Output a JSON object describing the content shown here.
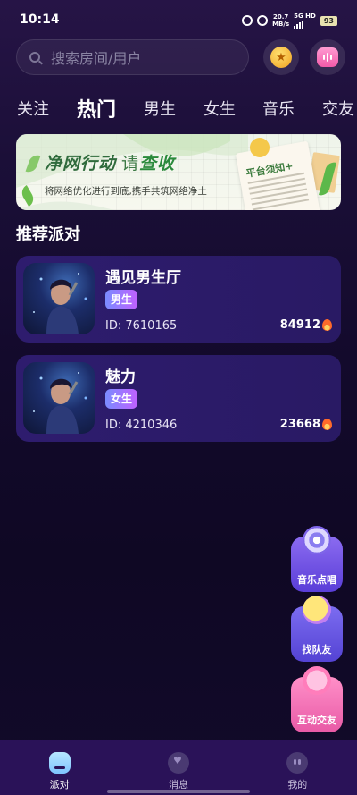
{
  "status_bar": {
    "time": "10:14",
    "net_speed": "20.7",
    "net_unit": "MB/s",
    "net_type": "5G HD",
    "battery": "93"
  },
  "header": {
    "search_placeholder": "搜索房间/用户"
  },
  "tabs": [
    "关注",
    "热门",
    "男生",
    "女生",
    "音乐",
    "交友"
  ],
  "active_tab": "热门",
  "banner": {
    "title": "净网行动",
    "title_suffix_1": "请",
    "title_suffix_2": "查收",
    "subtitle": "将网络优化进行到底,携手共筑网络净土",
    "notice_title": "平台须知+"
  },
  "section_title": "推荐派对",
  "rooms": [
    {
      "name": "遇见男生厅",
      "tag": "男生",
      "id": "ID: 7610165",
      "heat": "84912"
    },
    {
      "name": "魅力",
      "tag": "女生",
      "id": "ID: 4210346",
      "heat": "23668"
    }
  ],
  "floating_actions": [
    {
      "label": "音乐点唱",
      "icon": "music-disc-icon"
    },
    {
      "label": "找队友",
      "icon": "team-icon"
    },
    {
      "label": "互动交友",
      "icon": "chat-heart-icon"
    }
  ],
  "bottom_nav": [
    {
      "label": "派对",
      "icon": "party-icon"
    },
    {
      "label": "消息",
      "icon": "message-icon"
    },
    {
      "label": "我的",
      "icon": "profile-icon"
    }
  ],
  "colors": {
    "background": "#130a2c",
    "card": "#2e1c6e",
    "nav": "#2a1258",
    "tag": "#a070ff"
  }
}
